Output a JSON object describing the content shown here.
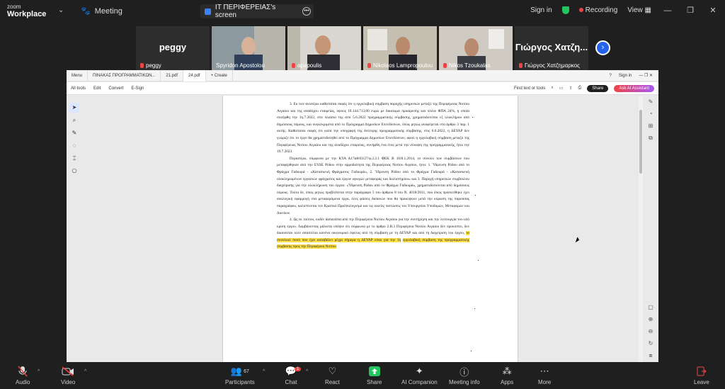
{
  "titlebar": {
    "app_small": "zoom",
    "app_big": "Workplace",
    "meeting_label": "Meeting",
    "share_tab": "IT ΠΕΡΙΦΕΡΕΙΑΣ's screen",
    "signin": "Sign in",
    "recording": "Recording",
    "view": "View"
  },
  "participants": [
    {
      "name": "peggy",
      "label": "peggy",
      "video": false
    },
    {
      "name": "",
      "label": "Spyridon Apostolou",
      "video": true,
      "bg": "#7a8a8f"
    },
    {
      "name": "",
      "label": "apapoulis",
      "video": true,
      "bg": "#c8c4be",
      "active": true
    },
    {
      "name": "",
      "label": "Nikolaos Lampropoulou",
      "video": true,
      "bg": "#b9b3a7"
    },
    {
      "name": "",
      "label": "Nikos Tzoukalas",
      "video": true,
      "bg": "#c9c6be"
    },
    {
      "name": "Γιώργος Χατζη...",
      "label": "Γιώργος Χατζημαρκος",
      "video": false
    }
  ],
  "acrobat": {
    "tabs": [
      "Menu",
      "ΠΙΝΑΚΑΣ ΠΡΟΓΡΑΜΜΑΤΙΚΩΝ...",
      "21.pdf",
      "24.pdf",
      "+ Create"
    ],
    "signin": "Sign in",
    "menu": [
      "All tools",
      "Edit",
      "Convert",
      "E-Sign"
    ],
    "find": "Find text or tools",
    "share": "Share",
    "ai": "Ask AI Assistant"
  },
  "document": {
    "p1": "3. Εκ των ανωτέρω καθίσταται σαφές ότι η εργολαβική σύμβαση παροχής υπηρεσιών μεταξύ της Περιφέρειας Νοτίου Αιγαίου και της αναδόχου εταιρείας, ύψους 18.144.713,00 ευρώ με δικαίωμα προαίρεσης και πλέον ΦΠΑ 24%, η οποία συνήφθη την 1η.7.2022, στο πλαίσιο της από 5.6.2022 προγραμματικής σύμβασης, χρηματοδοτείται εξ ολοκλήρου από δημόσιους πόρους, και συγκεκριμένα από το Πρόγραμμα Δημοσίων Επενδύσεων, όπως ρητώς αναφέρεται στο άρθρο 3 παρ. 1 αυτής. Καθίσταται σαφές ότι κατά την υπογραφή της δεύτερης προγραμματικής σύμβασης, στις 6.6.2022, η ΔΕΥΑΡ δεν γνώριζε ότι το έργο θα χρηματοδοτηθεί από το Πρόγραμμα Δημοσίων Επενδύσεων, αφού η εργολαβική σύμβαση μεταξύ της Περιφέρειας Νοτίου Αιγαίου και της αναδόχου εταιρείας, συνήφθη ένα έτος μετά την σύναψη της προγραμματικής, ήτοι την 19.7.2023.",
    "p2": "Περαιτέρω, σύμφωνα με την ΚΥΑ Α17αθ/03/27/φ.2.2.1 ΦΕΚ Β 10/8.1.2014, το σύνολο των συμβάσεων που μεταφέρθηκαν από την ΕΥΔΕ Ρόδου στην αρμοδιότητα της Περιφέρειας Νοτίου Αιγαίου, ήτοι: 1. Ύδρευση Ρόδου από το Φράγμα Γαδουρά - «Κατασκευή Φράγματος Γαδουρά», 2. Ύδρευση Ρόδου από το Φράγμα Γαδουρά - «Κατασκευή ολοκληρωμένων εργασιών φράγματος και έργων αγωγών μεταφοράς και διυλιστηρίου» και 3. Παροχή υπηρεσιών συμβούλου διαχείρισης για την ολοκλήρωση του έργου: «Ύδρευση Ρόδου από το Φράγμα Γαδουρά», χρηματοδοτούνται από δημόσιους πόρους. Τούτο δε, όπως ρητώς προβλέπεται στην παράγραφο 5 του άρθρου 8 του Ν. 4018/2011, που όπως προεκτέθηκε έχει αναλογική εφαρμογή στα μεταφερόμενα έργα, όλες φάσεις δαπανών που θα προκύψουν μετά την κύρωση της παρούσας παραγράφου, καλύπτονται τον Κρατικό Προϋπολογισμό και τις οικείες πιστώσεις του Υπουργείου Υποδομών, Μεταφορών και Δικτύων.",
    "p3a": "4. Ως εκ τούτου, ουδέν δαπανάται από την Περιφέρεια Νοτίου Αιγαίου για την συντήρηση και την λειτουργία του υπό κρίση έργου. Λαμβάνοντας μάλιστα υπόψιν ότι σύμφωνα με το άρθρο 2.Β.3 Περιφέρεια Νοτίου Αιγαίου δεν προκύπτει, δεν δικαιούται ούτε απαιτείται κανένα οικονομικό όφελος από τη σύμβαση με τη ΔΕΥΑΡ και από τη διαχείριση του έργου,",
    "p3hl": "το συνολικό ποσό που έχει καταβάλει μέχρι σήμερα η ΔΕΥΑΡ είναι για την 1η",
    "p3b": "εργολαβική σύμβαση της προγραμματικής σύμβασης προς την Περιφέρεια Νοτίου"
  },
  "toolbar": {
    "audio": "Audio",
    "video": "Video",
    "participants": "Participants",
    "participants_count": "67",
    "chat": "Chat",
    "chat_badge": "1",
    "react": "React",
    "share": "Share",
    "ai": "AI Companion",
    "meeting_info": "Meeting info",
    "apps": "Apps",
    "more": "More",
    "leave": "Leave"
  },
  "colors": {
    "accent": "#22c55e",
    "share": "#22c55e",
    "leave": "#ef4444",
    "highlight": "#fde047"
  }
}
